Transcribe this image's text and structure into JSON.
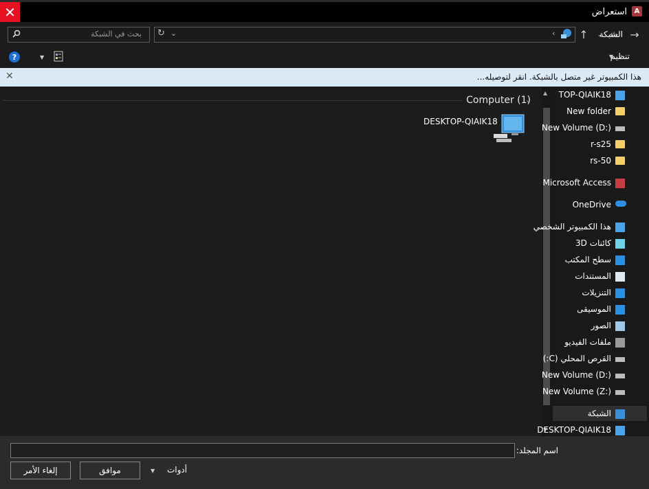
{
  "window": {
    "title": "استعراض",
    "app_icon": "access-app-icon",
    "close_color": "#e81123"
  },
  "nav": {
    "address": "الشبكة",
    "search_placeholder": "بحث في الشبكة"
  },
  "toolbar": {
    "organize_label": "تنظيم"
  },
  "infobar": {
    "message": "هذا الكمبيوتر غير متصل بالشبكة. انقر لتوصيله...",
    "background": "#daeaf7"
  },
  "main": {
    "group_label": "Computer (1)",
    "items": [
      {
        "name": "DESKTOP-QIAIK18"
      }
    ]
  },
  "tree": [
    {
      "label": "TOP-QIAIK18",
      "icon": "computer-icon"
    },
    {
      "label": "New folder",
      "icon": "folder-icon"
    },
    {
      "label": "New Volume (D:)",
      "icon": "drive-icon"
    },
    {
      "label": "r-s25",
      "icon": "folder-icon"
    },
    {
      "label": "rs-50",
      "icon": "folder-icon"
    },
    {
      "label": "Microsoft Access",
      "icon": "access-icon"
    },
    {
      "label": "OneDrive",
      "icon": "cloud-icon"
    },
    {
      "label": "هذا الكمبيوتر الشخصي",
      "icon": "computer-icon"
    },
    {
      "label": "كائنات 3D",
      "icon": "cube-icon"
    },
    {
      "label": "سطح المكتب",
      "icon": "desktop-icon"
    },
    {
      "label": "المستندات",
      "icon": "document-icon"
    },
    {
      "label": "التنزيلات",
      "icon": "download-icon"
    },
    {
      "label": "الموسيقى",
      "icon": "music-icon"
    },
    {
      "label": "الصور",
      "icon": "picture-icon"
    },
    {
      "label": "ملفات الفيديو",
      "icon": "video-icon"
    },
    {
      "label": "القرص المحلي (C:)",
      "icon": "drive-icon"
    },
    {
      "label": "New Volume (D:)",
      "icon": "drive-icon"
    },
    {
      "label": "New Volume (Z:)",
      "icon": "network-drive-icon"
    },
    {
      "label": "الشبكة",
      "icon": "network-icon"
    },
    {
      "label": "DESKTOP-QIAIK18",
      "icon": "computer-icon"
    }
  ],
  "bottom": {
    "folder_name_label": "اسم المجلد:",
    "folder_name_value": "",
    "tools_label": "أدوات",
    "ok_label": "موافق",
    "cancel_label": "إلغاء الأمر"
  }
}
